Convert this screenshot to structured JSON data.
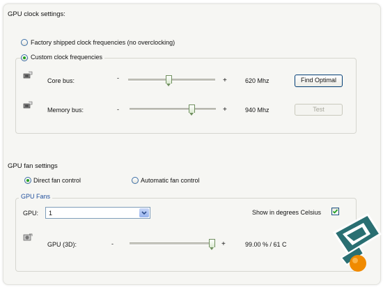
{
  "clock": {
    "heading": "GPU clock settings:",
    "factory_option": "Factory shipped clock frequencies (no overclocking)",
    "custom_option": "Custom clock frequencies",
    "selected": "custom",
    "core": {
      "label": "Core bus:",
      "minus": "-",
      "plus": "+",
      "value": "620 Mhz",
      "level": 0.47,
      "button": "Find Optimal"
    },
    "memory": {
      "label": "Memory bus:",
      "minus": "-",
      "plus": "+",
      "value": "940 Mhz",
      "level": 0.72,
      "button": "Test"
    }
  },
  "fan": {
    "heading": "GPU fan settings",
    "direct_option": "Direct fan control",
    "auto_option": "Automatic fan control",
    "selected": "direct",
    "fans_group": "GPU Fans",
    "gpu_label": "GPU:",
    "gpu_value": "1",
    "celsius_label": "Show in degrees Celsius",
    "celsius_checked": true,
    "gpu3d": {
      "label": "GPU (3D):",
      "minus": "-",
      "plus": "+",
      "value": "99.00 % / 61 C",
      "level": 0.99
    }
  },
  "colors": {
    "accent": "#3c6ea5",
    "logo_teal": "#2a6f72",
    "logo_orange": "#f08a00",
    "radio_dot": "#21a121"
  }
}
